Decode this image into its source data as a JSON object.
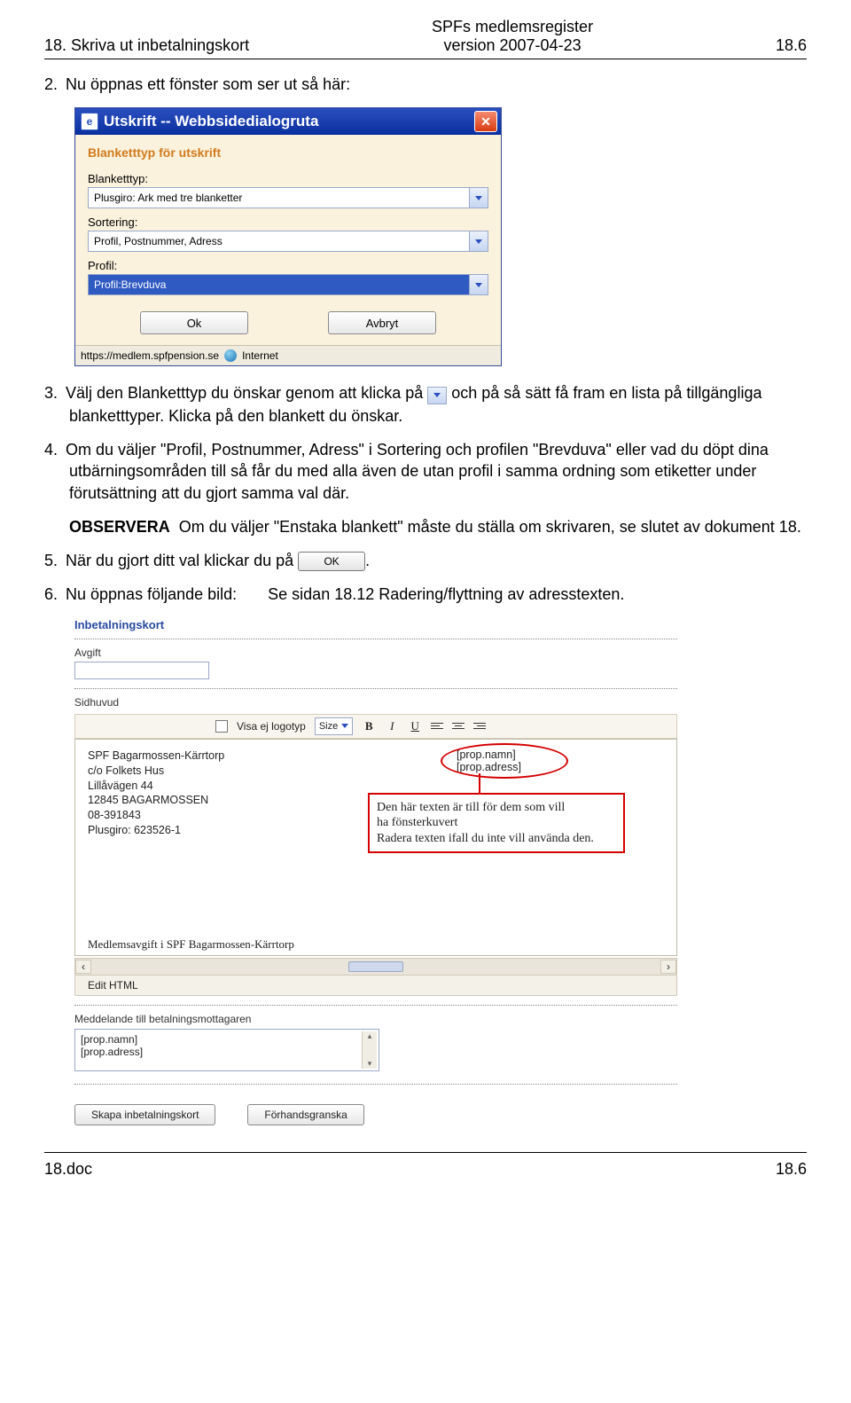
{
  "header": {
    "left": "18. Skriva ut inbetalningskort",
    "center_line1": "SPFs medlemsregister",
    "center_line2": "version 2007-04-23",
    "right": "18.6"
  },
  "footer": {
    "left": "18.doc",
    "right": "18.6"
  },
  "para2": {
    "num": "2.",
    "text": "Nu öppnas ett fönster som ser ut så här:"
  },
  "dialog": {
    "title": "Utskrift -- Webbsidedialogruta",
    "section": "Blanketttyp för utskrift",
    "f1_label": "Blanketttyp:",
    "f1_value": "Plusgiro: Ark med tre blanketter",
    "f2_label": "Sortering:",
    "f2_value": "Profil, Postnummer, Adress",
    "f3_label": "Profil:",
    "f3_value": "Profil:Brevduva",
    "ok": "Ok",
    "cancel": "Avbryt",
    "status_url": "https://medlem.spfpension.se",
    "status_zone": "Internet"
  },
  "para3": {
    "num": "3.",
    "before": "Välj den Blanketttyp du önskar genom att klicka på",
    "after": "och på så sätt få fram en lista på tillgängliga blanketttyper. Klicka på den blankett du önskar."
  },
  "para4": {
    "num": "4.",
    "text": "Om du väljer \"Profil, Postnummer, Adress\" i Sortering och profilen \"Brevduva\" eller vad du döpt dina utbärningsområden till så får du med alla även de utan profil i samma ordning som etiketter under förutsättning att du gjort samma val där."
  },
  "obs": {
    "bold": "OBSERVERA",
    "text": "Om du väljer \"Enstaka blankett\" måste du ställa om skrivaren, se slutet av dokument 18."
  },
  "para5": {
    "num": "5.",
    "text": "När du gjort ditt val klickar du på",
    "ok_label": "OK"
  },
  "para6": {
    "num": "6.",
    "text": "Nu öppnas följande bild:",
    "extra": "Se sidan 18.12 Radering/flyttning av adresstexten."
  },
  "editor": {
    "title": "Inbetalningskort",
    "avgift_label": "Avgift",
    "sidhuvud_label": "Sidhuvud",
    "visa_ej": "Visa ej logotyp",
    "size": "Size",
    "addr": [
      "SPF Bagarmossen-Kärrtorp",
      "c/o Folkets Hus",
      "Lillåvägen 44",
      "12845 BAGARMOSSEN",
      "08-391843",
      "Plusgiro: 623526-1"
    ],
    "prop1": "[prop.namn]",
    "prop2": "[prop.adress]",
    "callout": [
      "Den här texten är till för dem som vill",
      "ha fönsterkuvert",
      "Radera texten ifall du inte vill använda den."
    ],
    "cut": "Medlemsavgift i SPF Bagarmossen-Kärrtorp",
    "edit_html": "Edit HTML",
    "med_label": "Meddelande till betalningsmottagaren",
    "med1": "[prop.namn]",
    "med2": "[prop.adress]",
    "btn1": "Skapa inbetalningskort",
    "btn2": "Förhandsgranska"
  }
}
